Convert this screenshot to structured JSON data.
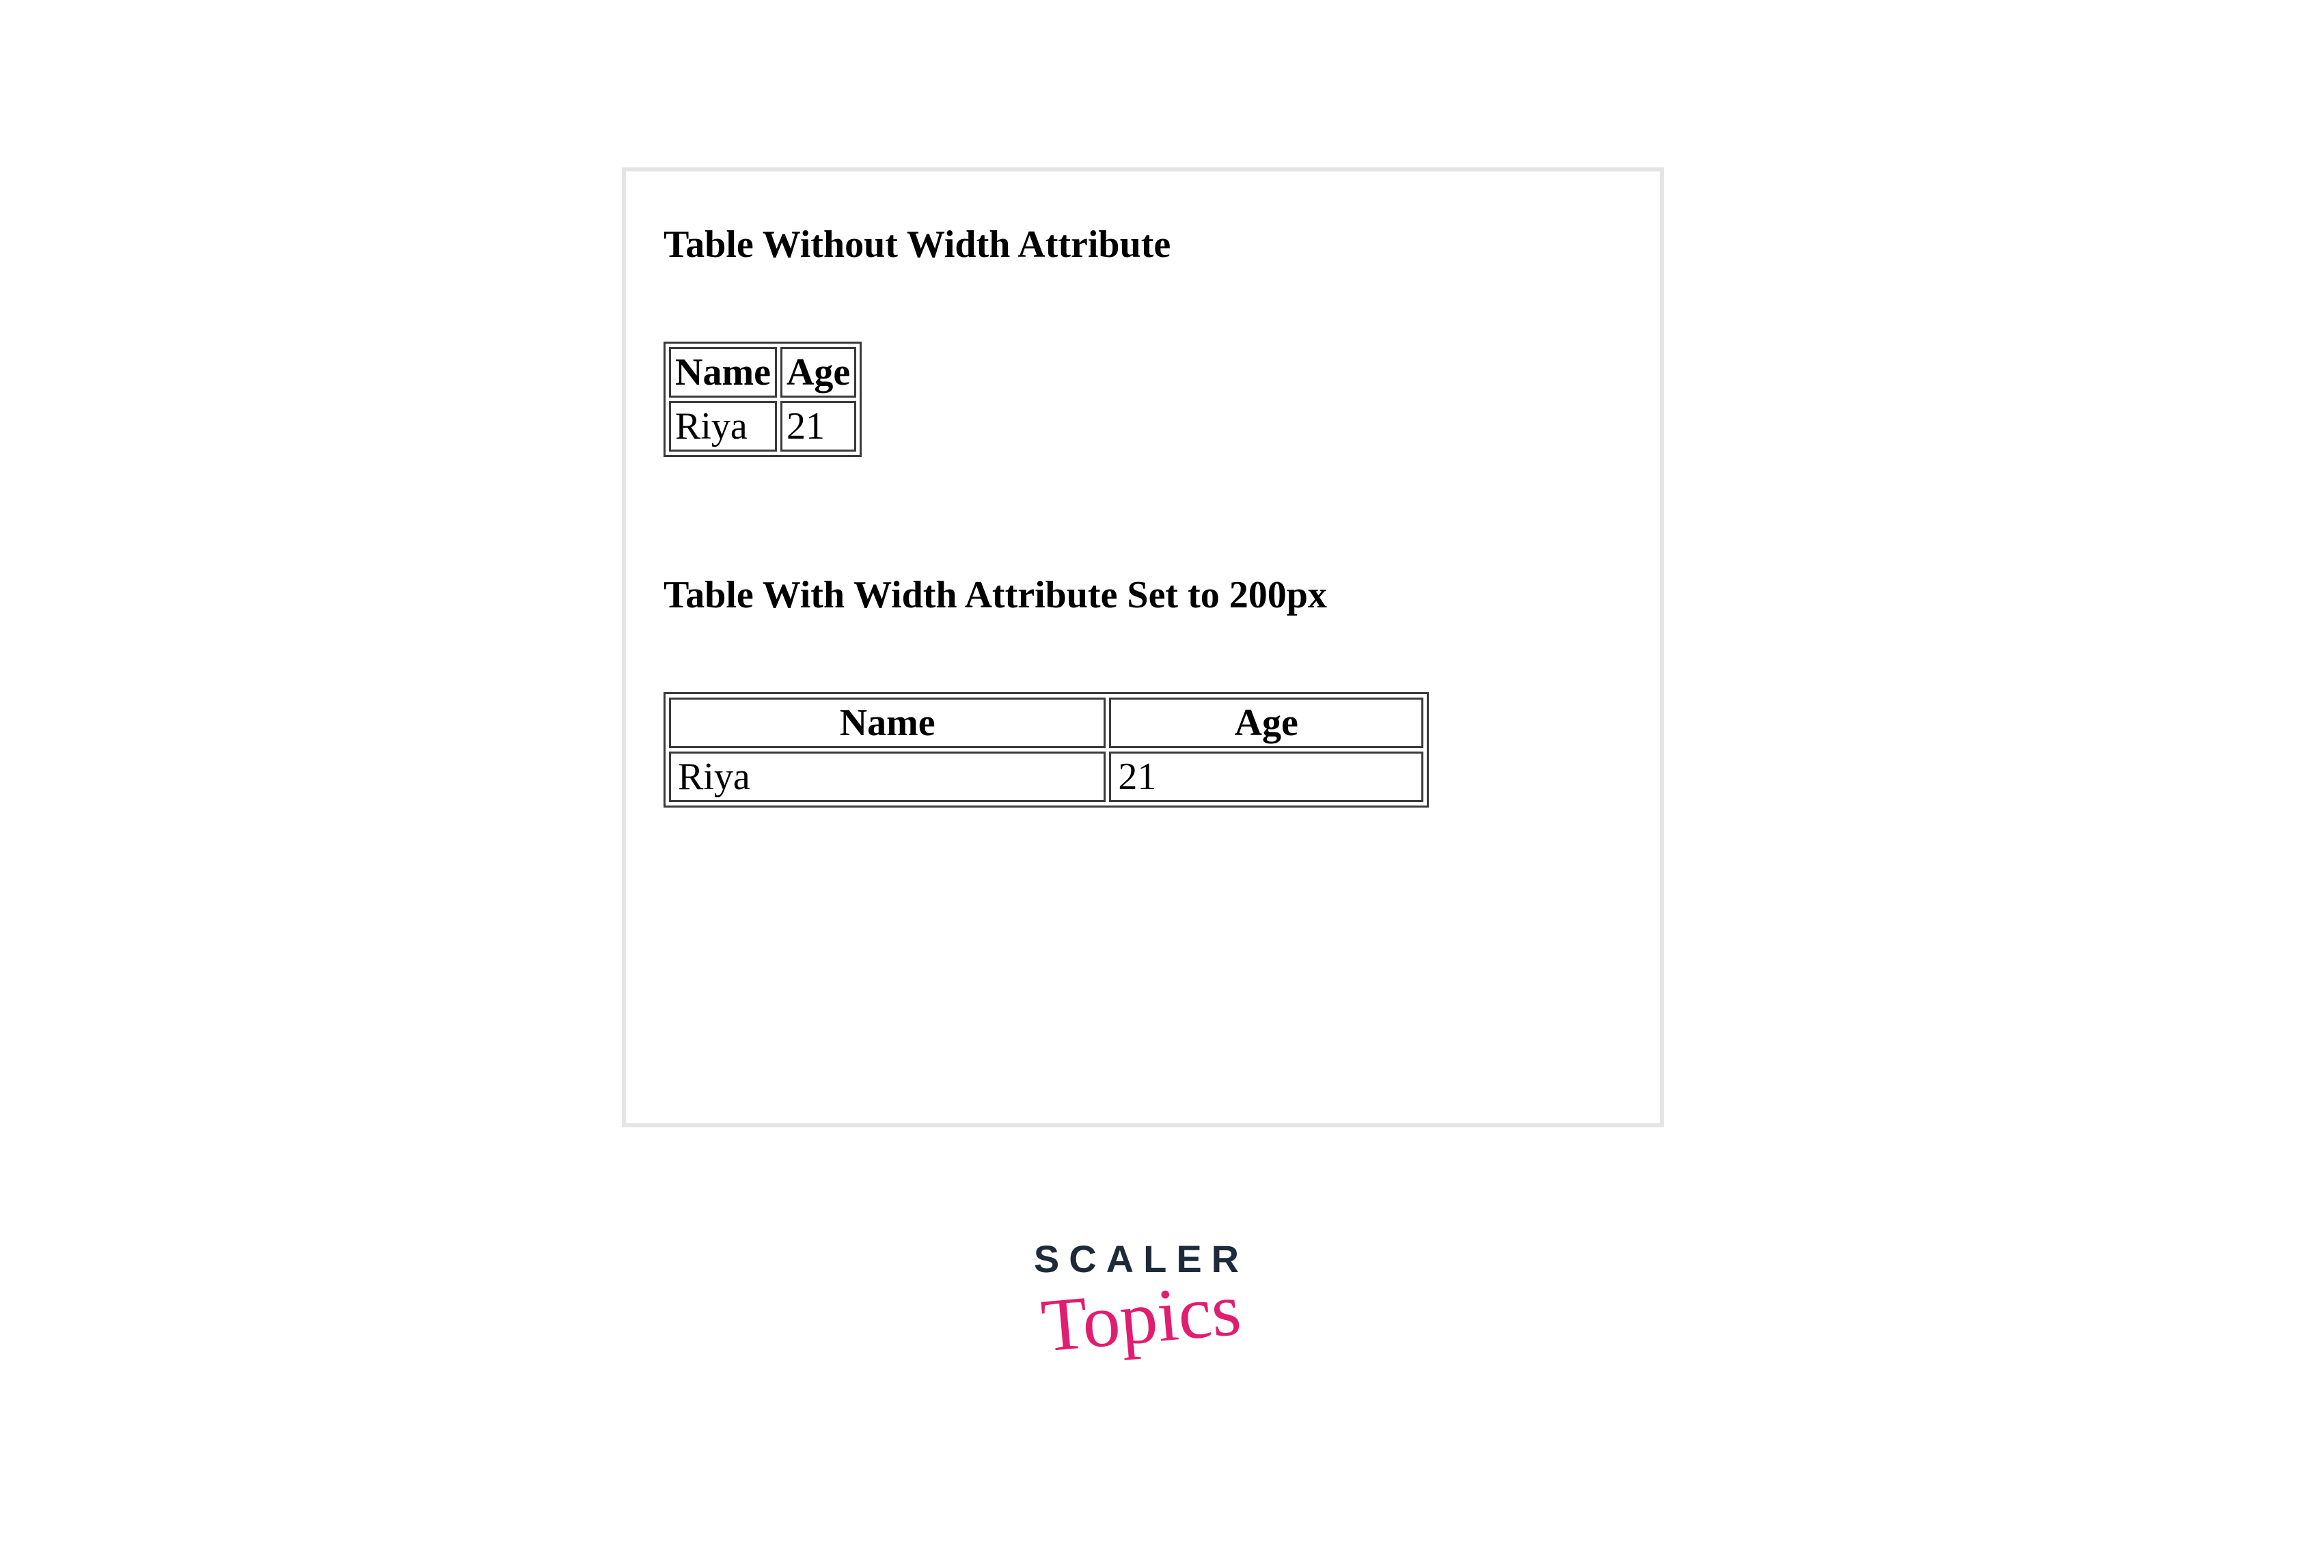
{
  "section1": {
    "heading": "Table Without Width Attribute",
    "headers": [
      "Name",
      "Age"
    ],
    "row": [
      "Riya",
      "21"
    ]
  },
  "section2": {
    "heading": "Table With Width Attribute Set to 200px",
    "headers": [
      "Name",
      "Age"
    ],
    "row": [
      "Riya",
      "21"
    ]
  },
  "logo": {
    "top": "SCALER",
    "bottom": "Topics"
  }
}
